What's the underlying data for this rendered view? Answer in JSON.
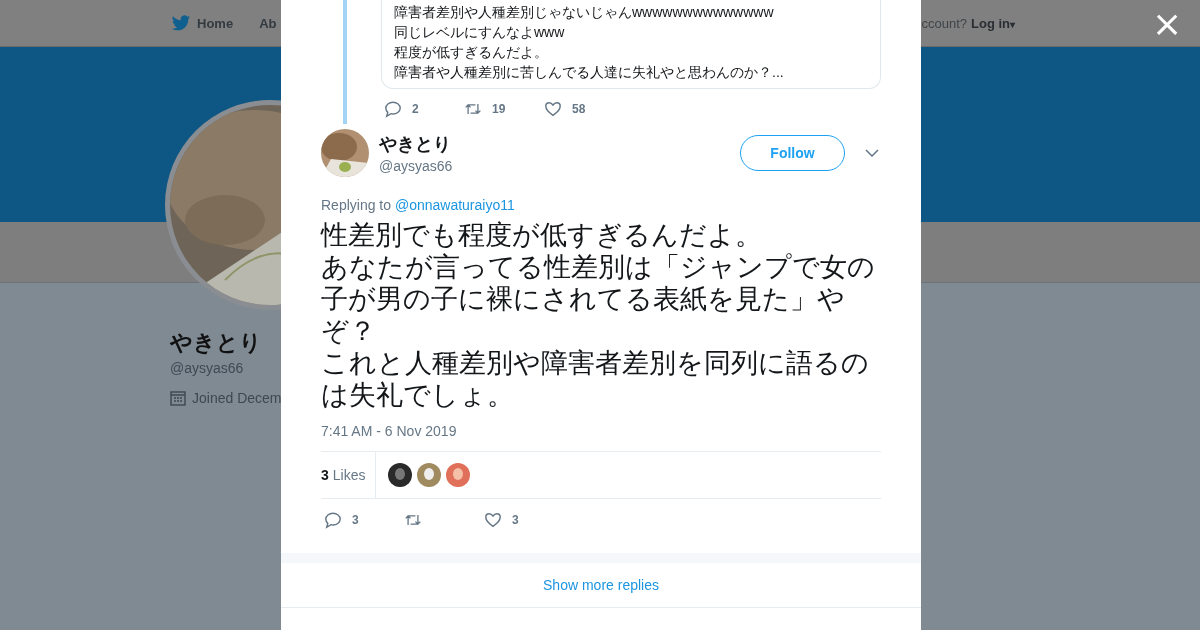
{
  "background_page": {
    "nav": [
      {
        "label": "Home",
        "kind": "home"
      },
      {
        "label": "Ab",
        "kind": "plain"
      }
    ],
    "account_prompt": "ccount?",
    "login": "Log in",
    "login_caret": "▾",
    "profile": {
      "name": "やきとり",
      "handle": "@aysyas66",
      "joined": "Joined Decem"
    }
  },
  "close_symbol": "×",
  "quoted_tweet": {
    "lines": [
      "障害者差別や人種差別じゃないじゃんwwwwwwwwwwwwww",
      "同じレベルにすんなよwww",
      "程度が低すぎるんだよ。",
      "障害者や人種差別に苦しんでる人達に失礼やと思わんのか？..."
    ],
    "actions": [
      {
        "kind": "reply",
        "count": "2"
      },
      {
        "kind": "retweet",
        "count": "19"
      },
      {
        "kind": "like",
        "count": "58"
      }
    ]
  },
  "tweet": {
    "name": "やきとり",
    "handle": "@aysyas66",
    "follow": "Follow",
    "replying_prefix": "Replying to",
    "replying_to": "@onnawaturaiyo11",
    "paragraphs": [
      "性差別でも程度が低すぎるんだよ。",
      "あなたが言ってる性差別は「ジャンプで女の子が男の子に裸にされてる表紙を見た」やぞ？",
      "これと人種差別や障害者差別を同列に語るのは失礼でしょ。"
    ],
    "time": "7:41 AM - 6 Nov 2019",
    "likes_count": "3",
    "likes_label": "Likes",
    "likers": [
      {
        "kind": "picture"
      },
      {
        "kind": "picture"
      },
      {
        "kind": "picture"
      }
    ],
    "actions": [
      {
        "kind": "reply",
        "count": "3"
      },
      {
        "kind": "retweet"
      },
      {
        "kind": "like",
        "count": "3"
      }
    ]
  },
  "show_more": "Show more replies"
}
